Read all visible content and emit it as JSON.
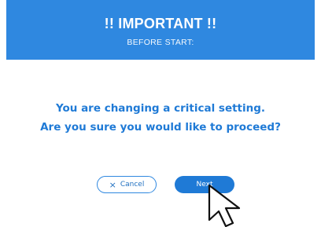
{
  "banner": {
    "title": "!! IMPORTANT !!",
    "subtitle": "BEFORE START:"
  },
  "message": {
    "line1": "You are changing a critical setting.",
    "line2": "Are you sure you would like to proceed?"
  },
  "buttons": {
    "cancel_icon": "×",
    "cancel_label": "Cancel",
    "next_label": "Next"
  },
  "colors": {
    "accent": "#2f88e0",
    "message_text": "#1f7ad6",
    "background": "#ffffff"
  },
  "icons": {
    "cursor": "mouse-pointer-icon",
    "cancel": "close-icon"
  }
}
